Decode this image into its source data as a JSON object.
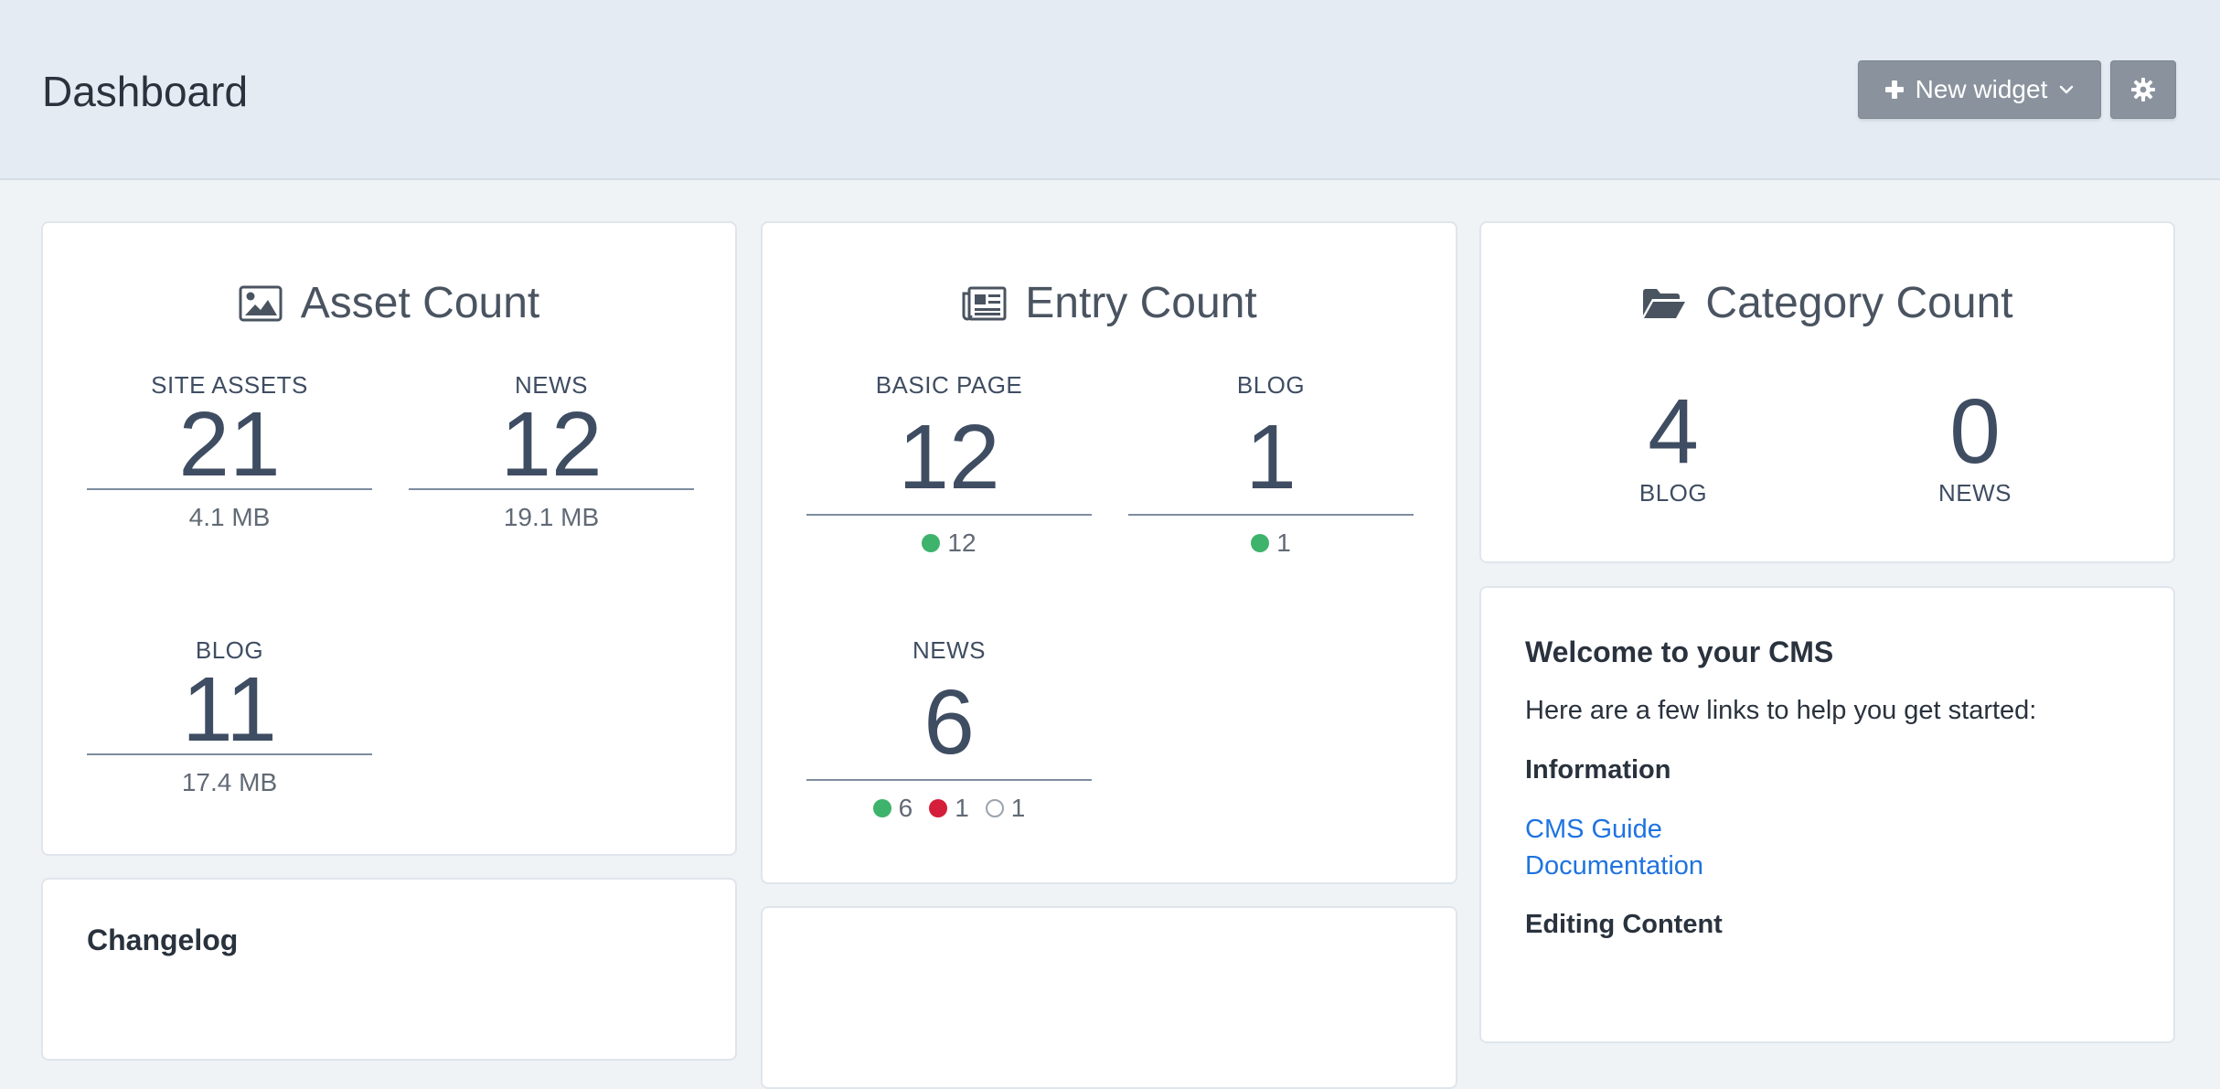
{
  "header": {
    "title": "Dashboard",
    "new_widget_label": "New widget",
    "new_widget_icon": "plus-icon",
    "dropdown_icon": "chevron-down-icon",
    "settings_icon": "gear-icon"
  },
  "asset_count": {
    "title": "Asset Count",
    "icon": "image-icon",
    "items": [
      {
        "label": "SITE ASSETS",
        "count": "21",
        "size": "4.1 MB"
      },
      {
        "label": "NEWS",
        "count": "12",
        "size": "19.1 MB"
      },
      {
        "label": "BLOG",
        "count": "11",
        "size": "17.4 MB"
      }
    ]
  },
  "entry_count": {
    "title": "Entry Count",
    "icon": "newspaper-icon",
    "items": [
      {
        "label": "BASIC PAGE",
        "count": "12",
        "live": "12"
      },
      {
        "label": "BLOG",
        "count": "1",
        "live": "1"
      },
      {
        "label": "NEWS",
        "count": "6",
        "live": "6",
        "pending": "1",
        "disabled": "1"
      }
    ]
  },
  "category_count": {
    "title": "Category Count",
    "icon": "folder-open-icon",
    "items": [
      {
        "count": "4",
        "label": "BLOG"
      },
      {
        "count": "0",
        "label": "NEWS"
      }
    ]
  },
  "welcome": {
    "title": "Welcome to your CMS",
    "intro": "Here are a few links to help you get started:",
    "information_heading": "Information",
    "links": [
      "CMS Guide",
      "Documentation"
    ],
    "editing_heading": "Editing Content"
  },
  "changelog": {
    "title": "Changelog"
  },
  "colors": {
    "header_bg": "#e4ebf2",
    "page_bg": "#eff3f6",
    "button_bg": "#8a939d",
    "live": "#3db36b",
    "pending": "#d41e3a",
    "link": "#1f73e0"
  }
}
